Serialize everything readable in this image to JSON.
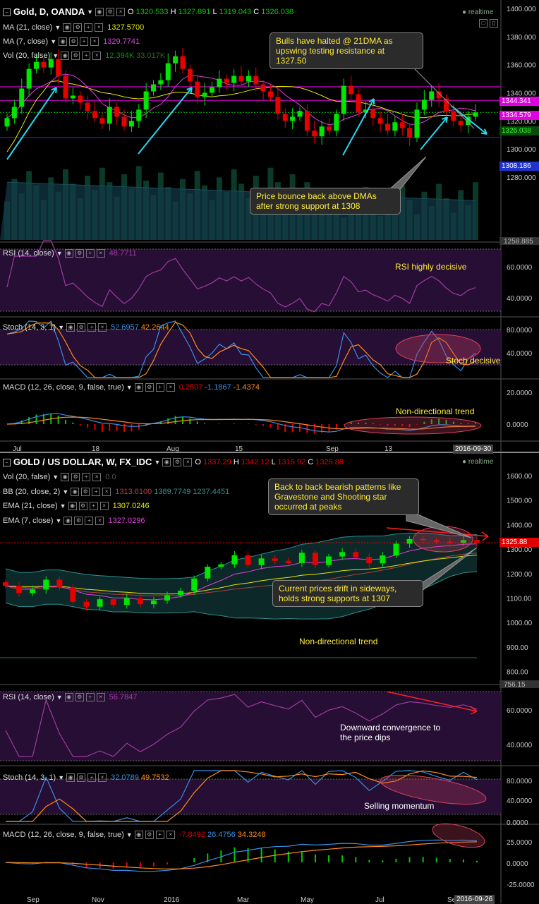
{
  "top": {
    "symbol": "Gold, D, OANDA",
    "o": "1320.533",
    "h": "1327.891",
    "l": "1319.043",
    "c": "1326.038",
    "realtime": "realtime",
    "ma21": {
      "label": "MA (21, close)",
      "value": "1327.5700"
    },
    "ma7": {
      "label": "MA (7, close)",
      "value": "1329.7741"
    },
    "vol": {
      "label": "Vol (20, false)",
      "v1": "12.394K",
      "v2": "33.017K"
    },
    "rsi": {
      "label": "RSI (14, close)",
      "value": "48.7711"
    },
    "stoch": {
      "label": "Stoch (14, 3, 1)",
      "k": "52.6957",
      "d": "42.2644"
    },
    "macd": {
      "label": "MACD (12, 26, close, 9, false, true)",
      "hist": "0.2507",
      "macd": "-1.1867",
      "signal": "-1.4374"
    },
    "price_axis": [
      "1400.000",
      "1380.000",
      "1360.000",
      "1340.000",
      "1320.000",
      "1300.000",
      "1280.000",
      "1258.885"
    ],
    "rsi_axis": [
      "60.0000",
      "40.0000"
    ],
    "stoch_axis": [
      "80.0000",
      "40.0000"
    ],
    "macd_axis": [
      "20.0000",
      "0.0000"
    ],
    "tags": [
      "1344.341",
      "1334.579",
      "1326.038",
      "1308.186"
    ],
    "dates": [
      "Jul",
      "18",
      "Aug",
      "15",
      "Sep",
      "13",
      "2016-09-30"
    ],
    "callout1": "Bulls have halted @ 21DMA as upswing testing resistance at 1327.50",
    "callout2": "Price bounce back above DMAs after strong support at 1308",
    "rsi_note": "RSI highly decisive",
    "stoch_note": "Stoch decisive",
    "macd_note": "Non-directional trend"
  },
  "bottom": {
    "symbol": "GOLD / US DOLLAR, W, FX_IDC",
    "o": "1337.29",
    "h": "1342.12",
    "l": "1315.92",
    "c": "1325.88",
    "realtime": "realtime",
    "vol": {
      "label": "Vol (20, false)",
      "value": "0.0"
    },
    "bb": {
      "label": "BB (20, close, 2)",
      "v1": "1313.6100",
      "v2": "1389.7749",
      "v3": "1237.4451"
    },
    "ema21": {
      "label": "EMA (21, close)",
      "value": "1307.0246"
    },
    "ema7": {
      "label": "EMA (7, close)",
      "value": "1327.0296"
    },
    "rsi": {
      "label": "RSI (14, close)",
      "value": "56.7847"
    },
    "stoch": {
      "label": "Stoch (14, 3, 1)",
      "k": "32.0789",
      "d": "49.7532"
    },
    "macd": {
      "label": "MACD (12, 26, close, 9, false, true)",
      "hist": "-7.8492",
      "macd": "26.4756",
      "signal": "34.3248"
    },
    "price_axis": [
      "1600.00",
      "1500.00",
      "1400.00",
      "1300.00",
      "1200.00",
      "1100.00",
      "1000.00",
      "900.00",
      "800.00",
      "756.15"
    ],
    "rsi_axis": [
      "60.0000",
      "40.0000"
    ],
    "stoch_axis": [
      "80.0000",
      "40.0000",
      "0.0000"
    ],
    "macd_axis": [
      "25.0000",
      "0.0000",
      "-25.0000"
    ],
    "tag": "1325.88",
    "dates": [
      "Sep",
      "Nov",
      "2016",
      "Mar",
      "May",
      "Jul",
      "Se",
      "2016-09-26"
    ],
    "callout1": "Back to back bearish patterns like Gravestone and Shooting star occurred at peaks",
    "callout2": "Current prices drift in sideways, holds strong supports at 1307",
    "trend_note": "Non-directional trend",
    "rsi_note": "Downward convergence to the price dips",
    "stoch_note": "Selling momentum"
  },
  "colors": {
    "up": "#00e600",
    "down": "#e60000",
    "ma_yellow": "#e8e800",
    "ma_pink": "#e040e0",
    "rsi": "#a03ca0",
    "stochK": "#3a8ee6",
    "stochD": "#ff8c1a",
    "arrow": "#29d6f0",
    "mag": "#e000e0",
    "red": "#ff2020"
  },
  "chart_data": [
    {
      "type": "candlestick",
      "title": "Gold, D, OANDA",
      "x": [
        "Jul",
        "18",
        "Aug",
        "15",
        "Sep",
        "13",
        "2016-09-30"
      ],
      "ylim": [
        1258.885,
        1400
      ],
      "horizontal_levels": [
        1344.341,
        1334.579,
        1326.038,
        1308.186
      ],
      "close": [
        1322,
        1330,
        1343,
        1357,
        1362,
        1358,
        1364,
        1352,
        1336,
        1338,
        1333,
        1327,
        1322,
        1318,
        1330,
        1323,
        1316,
        1320,
        1328,
        1341,
        1346,
        1349,
        1361,
        1366,
        1357,
        1348,
        1337,
        1340,
        1344,
        1350,
        1347,
        1352,
        1348,
        1352,
        1346,
        1341,
        1337,
        1325,
        1320,
        1323,
        1327,
        1313,
        1309,
        1316,
        1313,
        1325,
        1345,
        1339,
        1326,
        1328,
        1322,
        1318,
        1313,
        1319,
        1315,
        1308,
        1328,
        1335,
        1341,
        1336,
        1327,
        1320,
        1317,
        1323,
        1326
      ]
    },
    {
      "type": "candlestick",
      "title": "GOLD / US DOLLAR, W, FX_IDC",
      "x": [
        "Sep",
        "Nov",
        "2016",
        "Mar",
        "May",
        "Jul",
        "Se",
        "2016-09-26"
      ],
      "ylim": [
        756.15,
        1600
      ],
      "close": [
        1150,
        1120,
        1135,
        1175,
        1145,
        1085,
        1065,
        1095,
        1072,
        1100,
        1075,
        1090,
        1112,
        1130,
        1180,
        1228,
        1238,
        1275,
        1235,
        1262,
        1252,
        1243,
        1285,
        1235,
        1270,
        1288,
        1268,
        1242,
        1274,
        1322,
        1341,
        1337,
        1330,
        1325,
        1337,
        1326
      ]
    }
  ]
}
